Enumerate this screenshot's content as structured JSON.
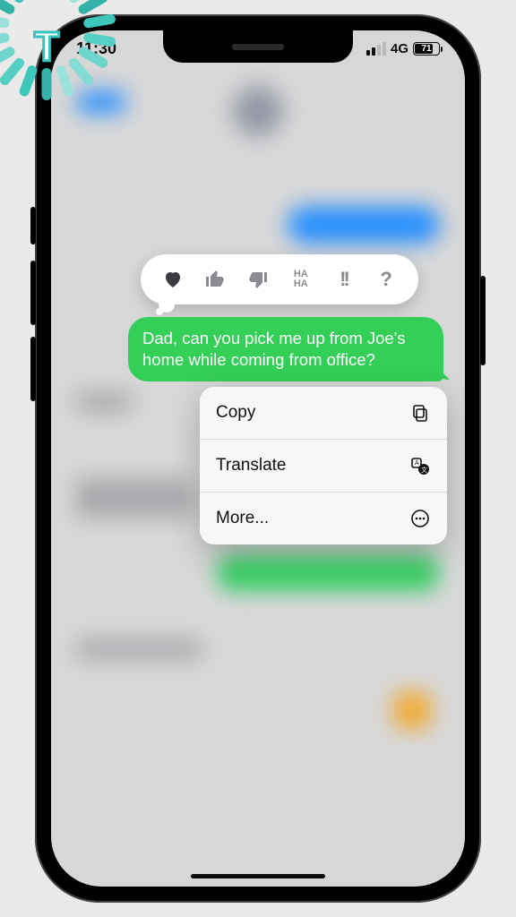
{
  "status": {
    "time": "11:30",
    "network": "4G",
    "battery": "71"
  },
  "tapback": {
    "reactions": [
      "heart",
      "thumbs-up",
      "thumbs-down",
      "haha",
      "exclaim",
      "question"
    ]
  },
  "message": {
    "text": "Dad, can you pick me up from Joe's home while coming from office?"
  },
  "context_menu": {
    "items": [
      {
        "label": "Copy",
        "icon": "copy-icon"
      },
      {
        "label": "Translate",
        "icon": "translate-icon"
      },
      {
        "label": "More...",
        "icon": "more-icon"
      }
    ]
  },
  "watermark": {
    "letter": "T"
  }
}
